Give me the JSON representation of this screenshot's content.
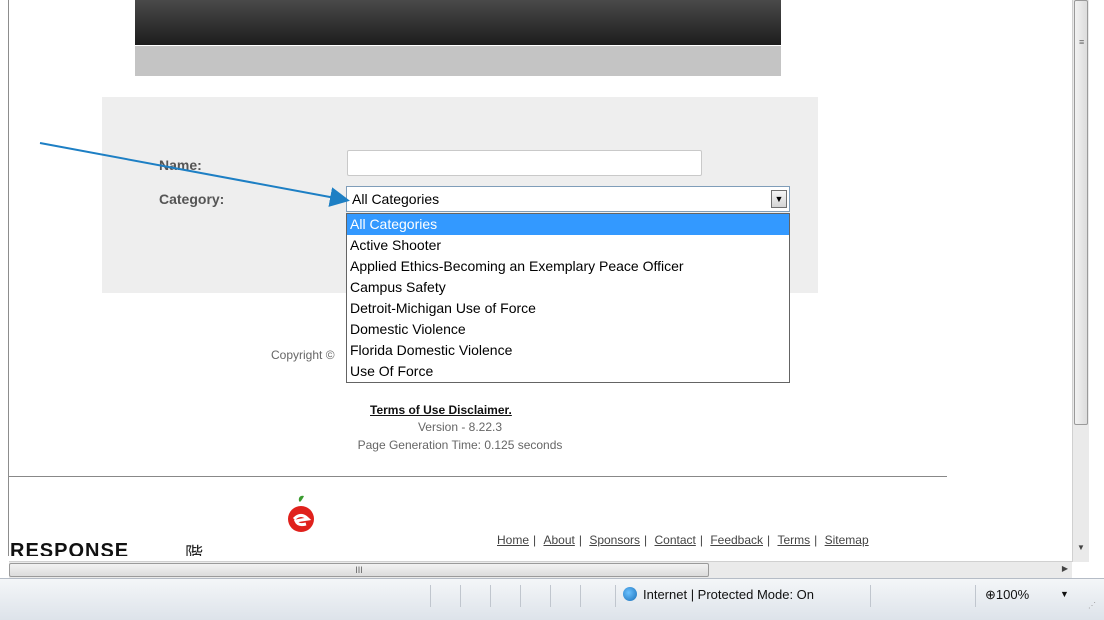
{
  "form": {
    "name_label": "Name:",
    "category_label": "Category:",
    "category_selected": "All Categories",
    "category_options": [
      "All Categories",
      "Active Shooter",
      "Applied Ethics-Becoming an Exemplary Peace Officer",
      "Campus Safety",
      "Detroit-Michigan Use of Force",
      "Domestic Violence",
      "Florida Domestic Violence",
      "Use Of Force"
    ]
  },
  "footer": {
    "copyright": "Copyright ©",
    "terms": "Terms of Use Disclaimer.",
    "version": "Version - 8.22.3",
    "page_generation": "Page Generation Time: 0.125 seconds",
    "links": [
      "Home",
      "About",
      "Sponsors",
      "Contact",
      "Feedback",
      "Terms",
      "Sitemap"
    ],
    "logo_text": "RESPONSE",
    "logo_char": "階"
  },
  "statusbar": {
    "zone": "Internet | Protected Mode: On",
    "zoom": "100%"
  },
  "icons": {
    "dropdown": "chevron-down-icon",
    "globe": "globe-icon",
    "zoom": "zoom-icon",
    "apple_logo": "apple-logo"
  },
  "colors": {
    "selection": "#3399ff",
    "arrow": "#1d7fc4",
    "header_dark": "#2b2b2b"
  }
}
